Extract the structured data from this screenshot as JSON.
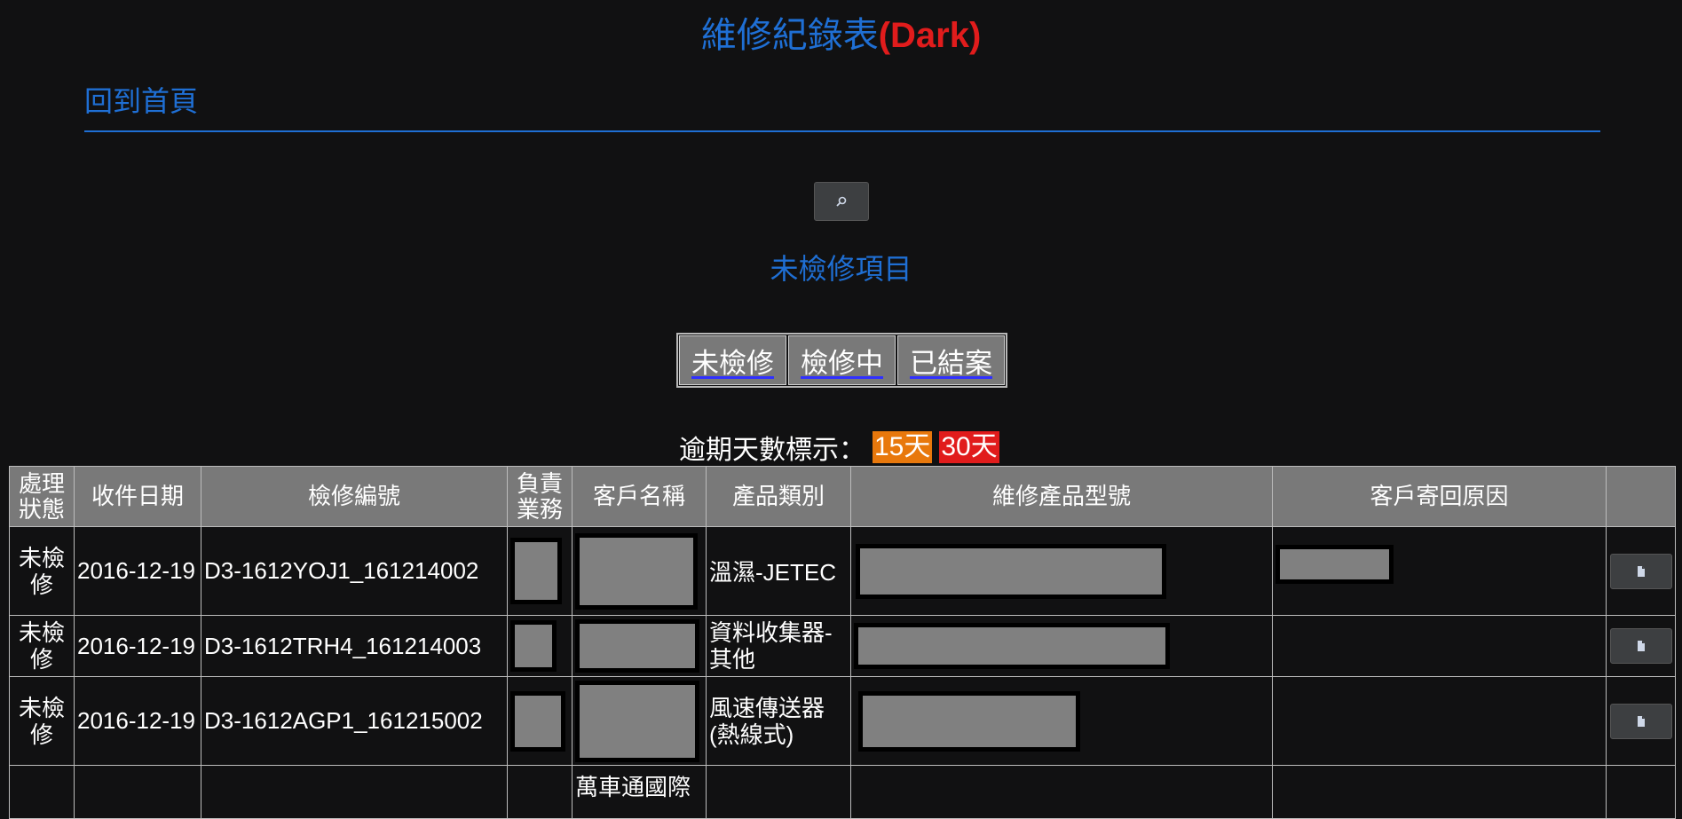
{
  "page": {
    "title_main": "維修紀錄表",
    "title_suffix": "(Dark)",
    "home_link": "回到首頁",
    "section_title": "未檢修項目"
  },
  "tabs": [
    {
      "label": "未檢修"
    },
    {
      "label": "檢修中"
    },
    {
      "label": "已結案"
    }
  ],
  "overdue": {
    "label": "逾期天數標示：",
    "badge_15": "15天",
    "badge_30": "30天",
    "color_15": "#e8780c",
    "color_30": "#e11c1c"
  },
  "table": {
    "headers": [
      "處理狀態",
      "收件日期",
      "檢修編號",
      "負責業務",
      "客戶名稱",
      "產品類別",
      "維修產品型號",
      "客戶寄回原因",
      ""
    ],
    "rows": [
      {
        "status": "未檢修",
        "date": "2016-12-19",
        "id": "D3-1612YOJ1_161214002",
        "category": "溫濕-JETEC"
      },
      {
        "status": "未檢修",
        "date": "2016-12-19",
        "id": "D3-1612TRH4_161214003",
        "category": "資料收集器-其他"
      },
      {
        "status": "未檢修",
        "date": "2016-12-19",
        "id": "D3-1612AGP1_161215002",
        "category": "風速傳送器(熱線式)"
      },
      {
        "status": "",
        "date": "",
        "id": "",
        "category": "",
        "customer_partial": "萬車通國際"
      }
    ]
  },
  "icons": {
    "search": "search-icon",
    "row_action": "document-icon"
  },
  "colors": {
    "accent": "#1f6fd4",
    "title_suffix": "#e11c1c",
    "background": "#111112",
    "header_bg": "#797979"
  }
}
